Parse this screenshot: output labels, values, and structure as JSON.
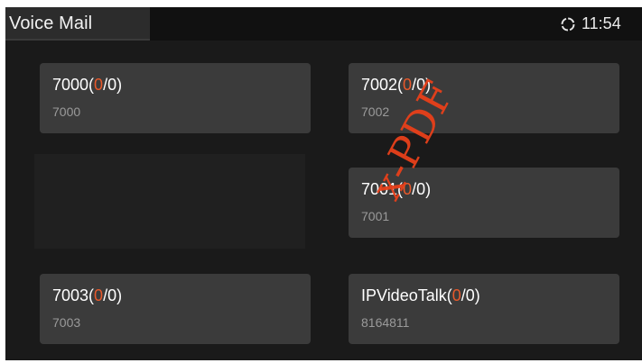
{
  "header": {
    "title": "Voice Mail",
    "status_icon": "sync-icon",
    "time": "11:54"
  },
  "voicemail_boxes": [
    {
      "name": "7000",
      "counts_open": "(",
      "new_count": "0",
      "counts_rest": "/0)",
      "extension": "7000"
    },
    {
      "name": "7002",
      "counts_open": "(",
      "new_count": "0",
      "counts_rest": "/0)",
      "extension": "7002"
    },
    {
      "name": "7001",
      "counts_open": "(",
      "new_count": "0",
      "counts_rest": "/0)",
      "extension": "7001"
    },
    {
      "name": "7003",
      "counts_open": "(",
      "new_count": "0",
      "counts_rest": "/0)",
      "extension": "7003"
    },
    {
      "name": "IPVideoTalk",
      "counts_open": "(",
      "new_count": "0",
      "counts_rest": "/0)",
      "extension": "8164811"
    }
  ],
  "colors": {
    "background": "#1a1a1a",
    "card": "#3b3b3b",
    "new_count_accent": "#e8592b",
    "watermark": "#e8401a"
  },
  "watermark": {
    "text": "x-PDF"
  }
}
